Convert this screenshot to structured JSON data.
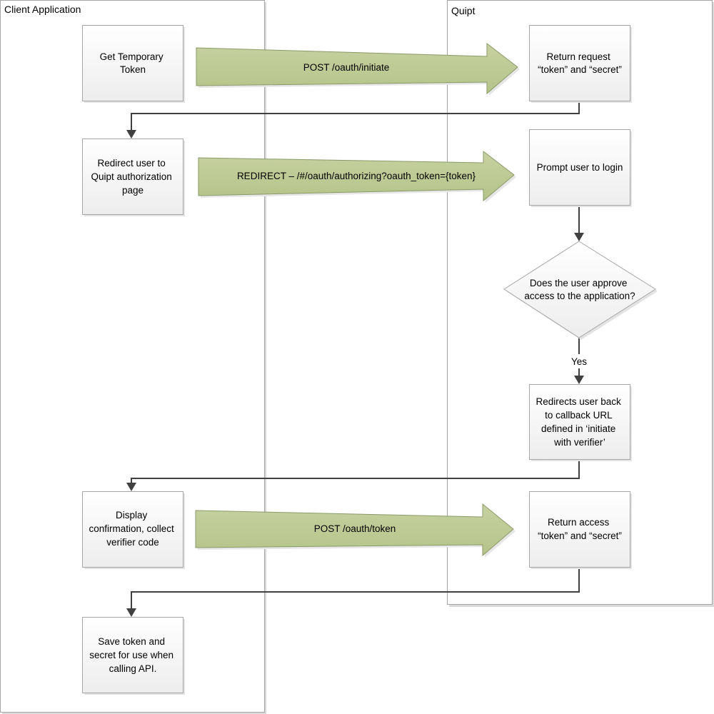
{
  "lanes": {
    "client": {
      "title": "Client Application"
    },
    "quipt": {
      "title": "Quipt"
    }
  },
  "steps": {
    "get_temp_token": {
      "lines": [
        "Get Temporary",
        "Token"
      ]
    },
    "return_request": {
      "lines": [
        "Return request",
        "“token” and “secret”"
      ]
    },
    "redirect_user": {
      "lines": [
        "Redirect user to",
        "Quipt authorization",
        "page"
      ]
    },
    "prompt_login": {
      "lines": [
        "Prompt user to login"
      ]
    },
    "decision": {
      "lines": [
        "Does the user approve",
        "access to the application?"
      ]
    },
    "redirect_back": {
      "lines": [
        "Redirects user back",
        "to callback URL",
        "defined in ‘initiate",
        "with verifier’"
      ]
    },
    "display_confirmation": {
      "lines": [
        "Display",
        "confirmation, collect",
        "verifier code"
      ]
    },
    "return_access": {
      "lines": [
        "Return access",
        "“token” and “secret”"
      ]
    },
    "save_token": {
      "lines": [
        "Save token and",
        "secret for use when",
        "calling API."
      ]
    }
  },
  "messages": {
    "initiate": "POST /oauth/initiate",
    "authorize": "REDIRECT – /#/oauth/authorizing?oauth_token={token}",
    "token": "POST /oauth/token"
  },
  "connector_labels": {
    "yes": "Yes"
  },
  "colors": {
    "arrow_fill": "#c0cc98",
    "box_fill": "#f2f2f2",
    "connector": "#404040"
  }
}
